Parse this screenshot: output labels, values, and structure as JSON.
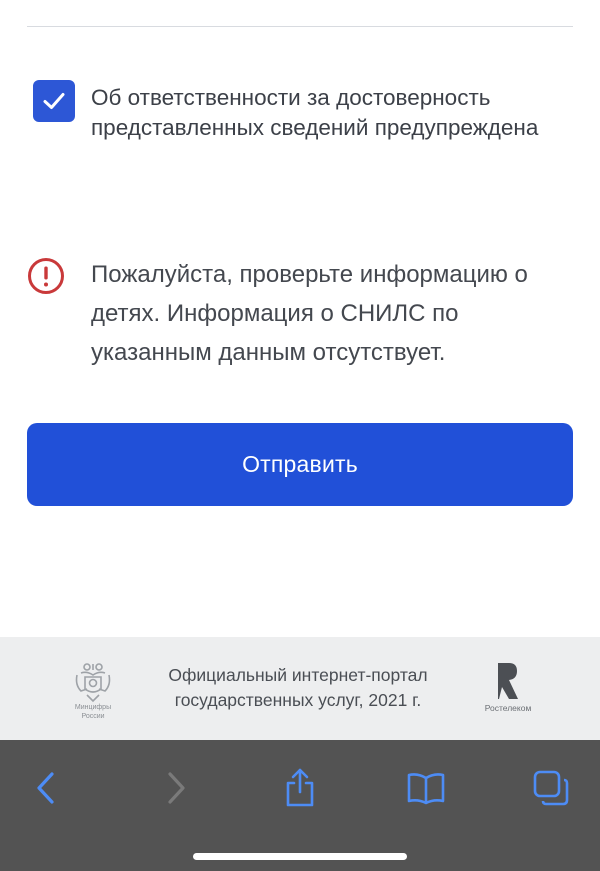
{
  "consent": {
    "checked": true,
    "text": "Об ответственности за достоверность представленных сведений предупреждена"
  },
  "warning": {
    "text": "Пожалуйста, проверьте информацию о детях. Информация о СНИЛС по указанным данным отсутствует."
  },
  "submit": {
    "label": "Отправить"
  },
  "footer": {
    "line1": "Официальный интернет-портал",
    "line2": "государственных услуг, 2021 г.",
    "left_logo_caption_1": "Минцифры",
    "left_logo_caption_2": "России",
    "right_logo_caption": "Ростелеком"
  },
  "browser_toolbar": {
    "icons": [
      "back-icon",
      "forward-icon",
      "share-icon",
      "bookmarks-icon",
      "tabs-icon"
    ]
  },
  "colors": {
    "accent": "#2150d8",
    "checkbox": "#2d57d6",
    "warning": "#c9393a",
    "toolbar": "#535353",
    "toolbar_icon_active": "#4d8cf5",
    "toolbar_icon_disabled": "#7a7a7a",
    "footer_bg": "#edeeef"
  }
}
